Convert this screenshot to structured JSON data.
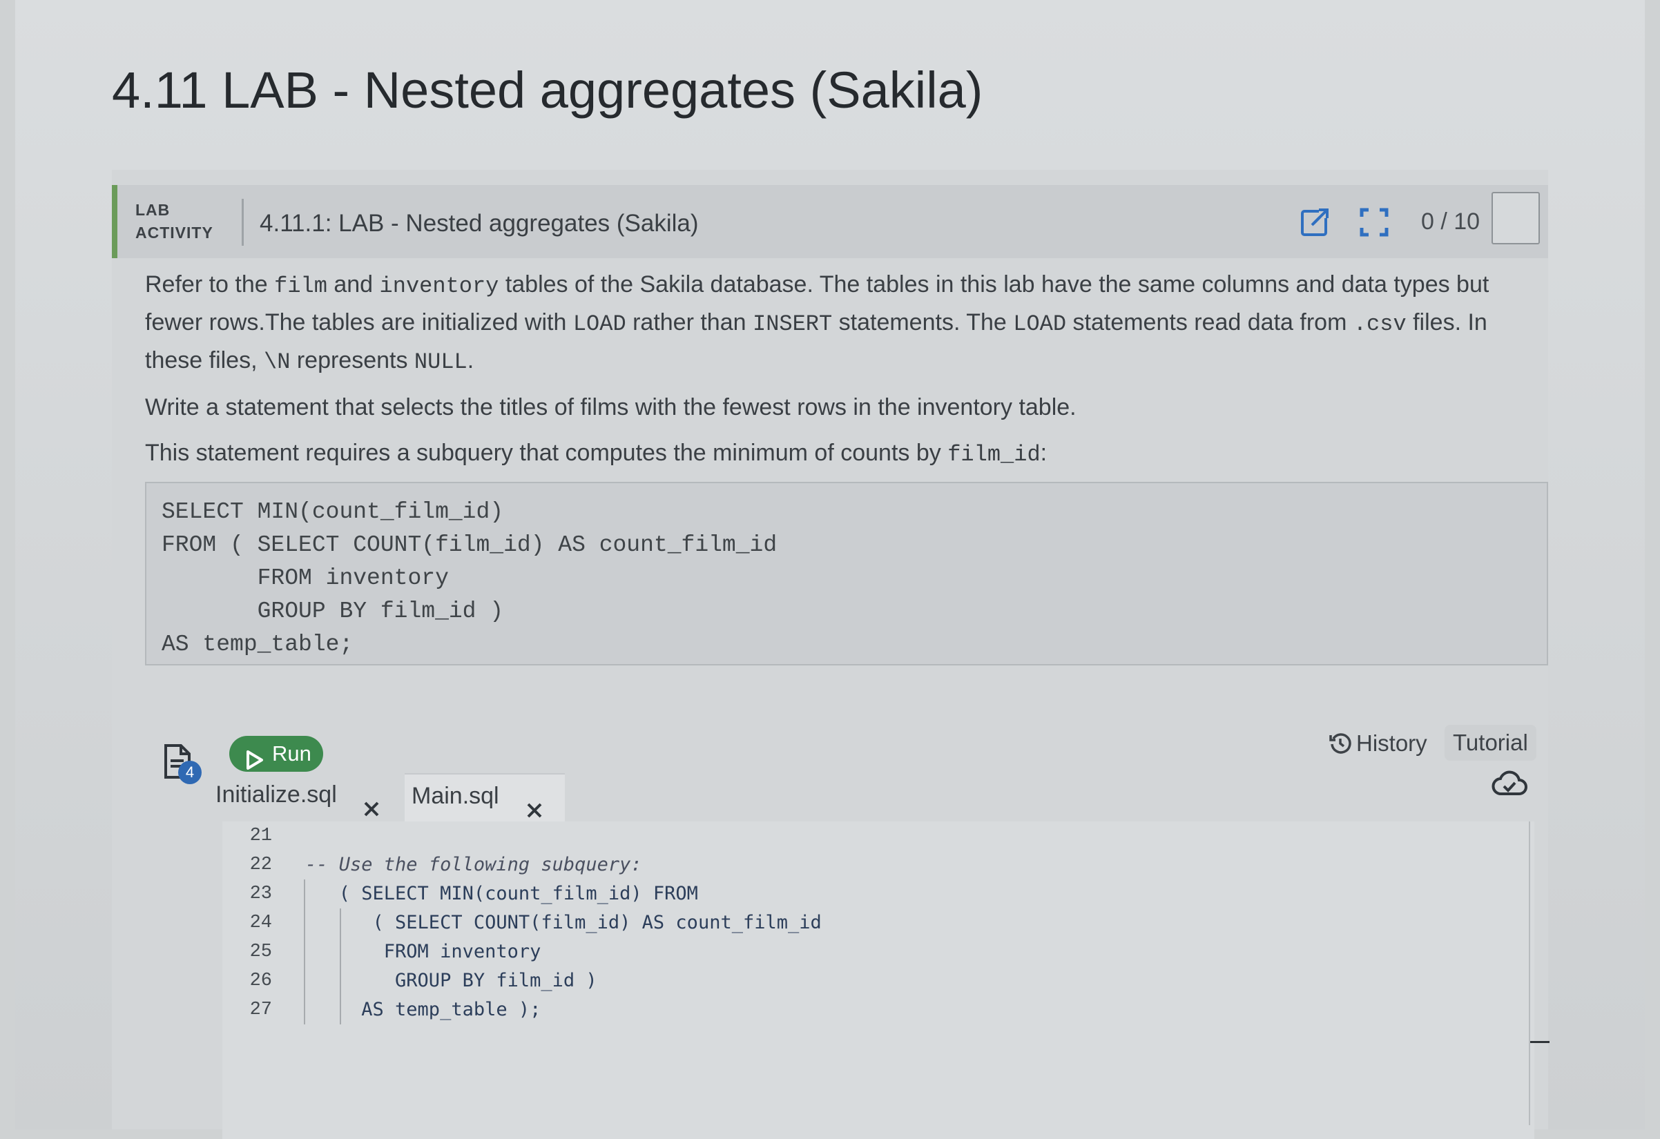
{
  "page_title": "4.11 LAB - Nested aggregates (Sakila)",
  "activity": {
    "label_line1": "LAB",
    "label_line2": "ACTIVITY",
    "title": "4.11.1: LAB - Nested aggregates (Sakila)",
    "score": "0 / 10",
    "icons": [
      "open-new-window-icon",
      "fullscreen-icon"
    ]
  },
  "instructions": {
    "p1": {
      "t1": "Refer to the ",
      "c1": "film",
      "t2": " and ",
      "c2": "inventory",
      "t3": " tables of the Sakila database. The tables in this lab have the same columns and data types but fewer rows.The tables are initialized with ",
      "c3": "LOAD",
      "t4": " rather than ",
      "c4": "INSERT",
      "t5": " statements. The ",
      "c5": "LOAD",
      "t6": " statements read data from ",
      "c6": ".csv",
      "t7": " files. In these files, ",
      "c7": "\\N",
      "t8": " represents ",
      "c8": "NULL",
      "t9": "."
    },
    "p2": "Write a statement that selects the titles of films with the fewest rows in the inventory table.",
    "p3": {
      "t1": "This statement requires a subquery that computes the minimum of counts by ",
      "c1": "film_id",
      "t2": ":"
    }
  },
  "code_example": [
    "SELECT MIN(count_film_id)",
    "FROM ( SELECT COUNT(film_id) AS count_film_id",
    "       FROM inventory",
    "       GROUP BY film_id )",
    "AS temp_table;"
  ],
  "toolbar": {
    "files_badge": "4",
    "run_label": "Run",
    "history_label": "History",
    "tutorial_label": "Tutorial"
  },
  "tabs": [
    {
      "label": "Initialize.sql",
      "active": false
    },
    {
      "label": "Main.sql",
      "active": true
    }
  ],
  "editor": {
    "line_numbers": [
      "21",
      "22",
      "23",
      "24",
      "25",
      "26",
      "27"
    ],
    "lines": [
      "",
      "-- Use the following subquery:",
      "   ( SELECT MIN(count_film_id) FROM",
      "      ( SELECT COUNT(film_id) AS count_film_id",
      "       FROM inventory",
      "        GROUP BY film_id )",
      "     AS temp_table );"
    ]
  },
  "colors": {
    "run_button": "#3d8a4e",
    "lab_accent": "#6b9b5a",
    "badge": "#2f69b3"
  }
}
